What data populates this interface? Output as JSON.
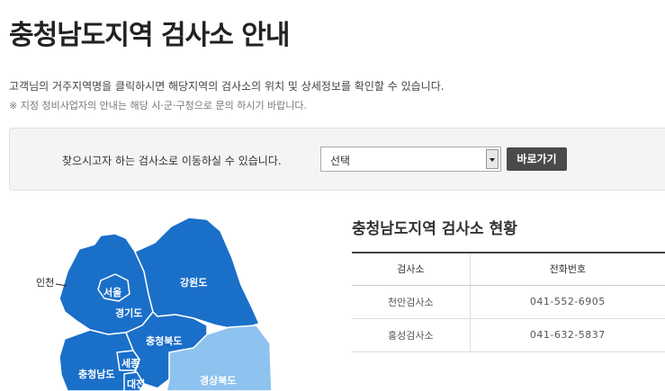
{
  "page": {
    "title": "충청남도지역 검사소 안내",
    "description": "고객님의 거주지역명을 클릭하시면 해당지역의 검사소의 위치 및 상세정보를 확인할 수 있습니다.",
    "note": "※ 지정 정비사업자의 안내는 해당 시·군·구청으로 문의 하시기 바랍니다."
  },
  "search": {
    "label": "찾으시고자 하는 검사소로 이동하실 수 있습니다.",
    "selected": "선택",
    "go_button": "바로가기"
  },
  "map": {
    "regions": [
      {
        "id": "incheon",
        "label": "인천"
      },
      {
        "id": "seoul",
        "label": "서울"
      },
      {
        "id": "gyeonggi",
        "label": "경기도"
      },
      {
        "id": "gangwon",
        "label": "강원도"
      },
      {
        "id": "chungbuk",
        "label": "충청북도"
      },
      {
        "id": "chungnam",
        "label": "충청남도"
      },
      {
        "id": "sejong",
        "label": "세종"
      },
      {
        "id": "daejeon",
        "label": "대전"
      },
      {
        "id": "gyeongbuk",
        "label": "경상북도"
      }
    ],
    "colors": {
      "region": "#1a6fc9",
      "highlight": "#8ec3ef",
      "border": "#ffffff"
    }
  },
  "stations": {
    "title": "충청남도지역 검사소 현황",
    "headers": [
      "검사소",
      "전화번호"
    ],
    "rows": [
      {
        "name": "천안검사소",
        "phone": "041-552-6905"
      },
      {
        "name": "홍성검사소",
        "phone": "041-632-5837"
      }
    ]
  }
}
